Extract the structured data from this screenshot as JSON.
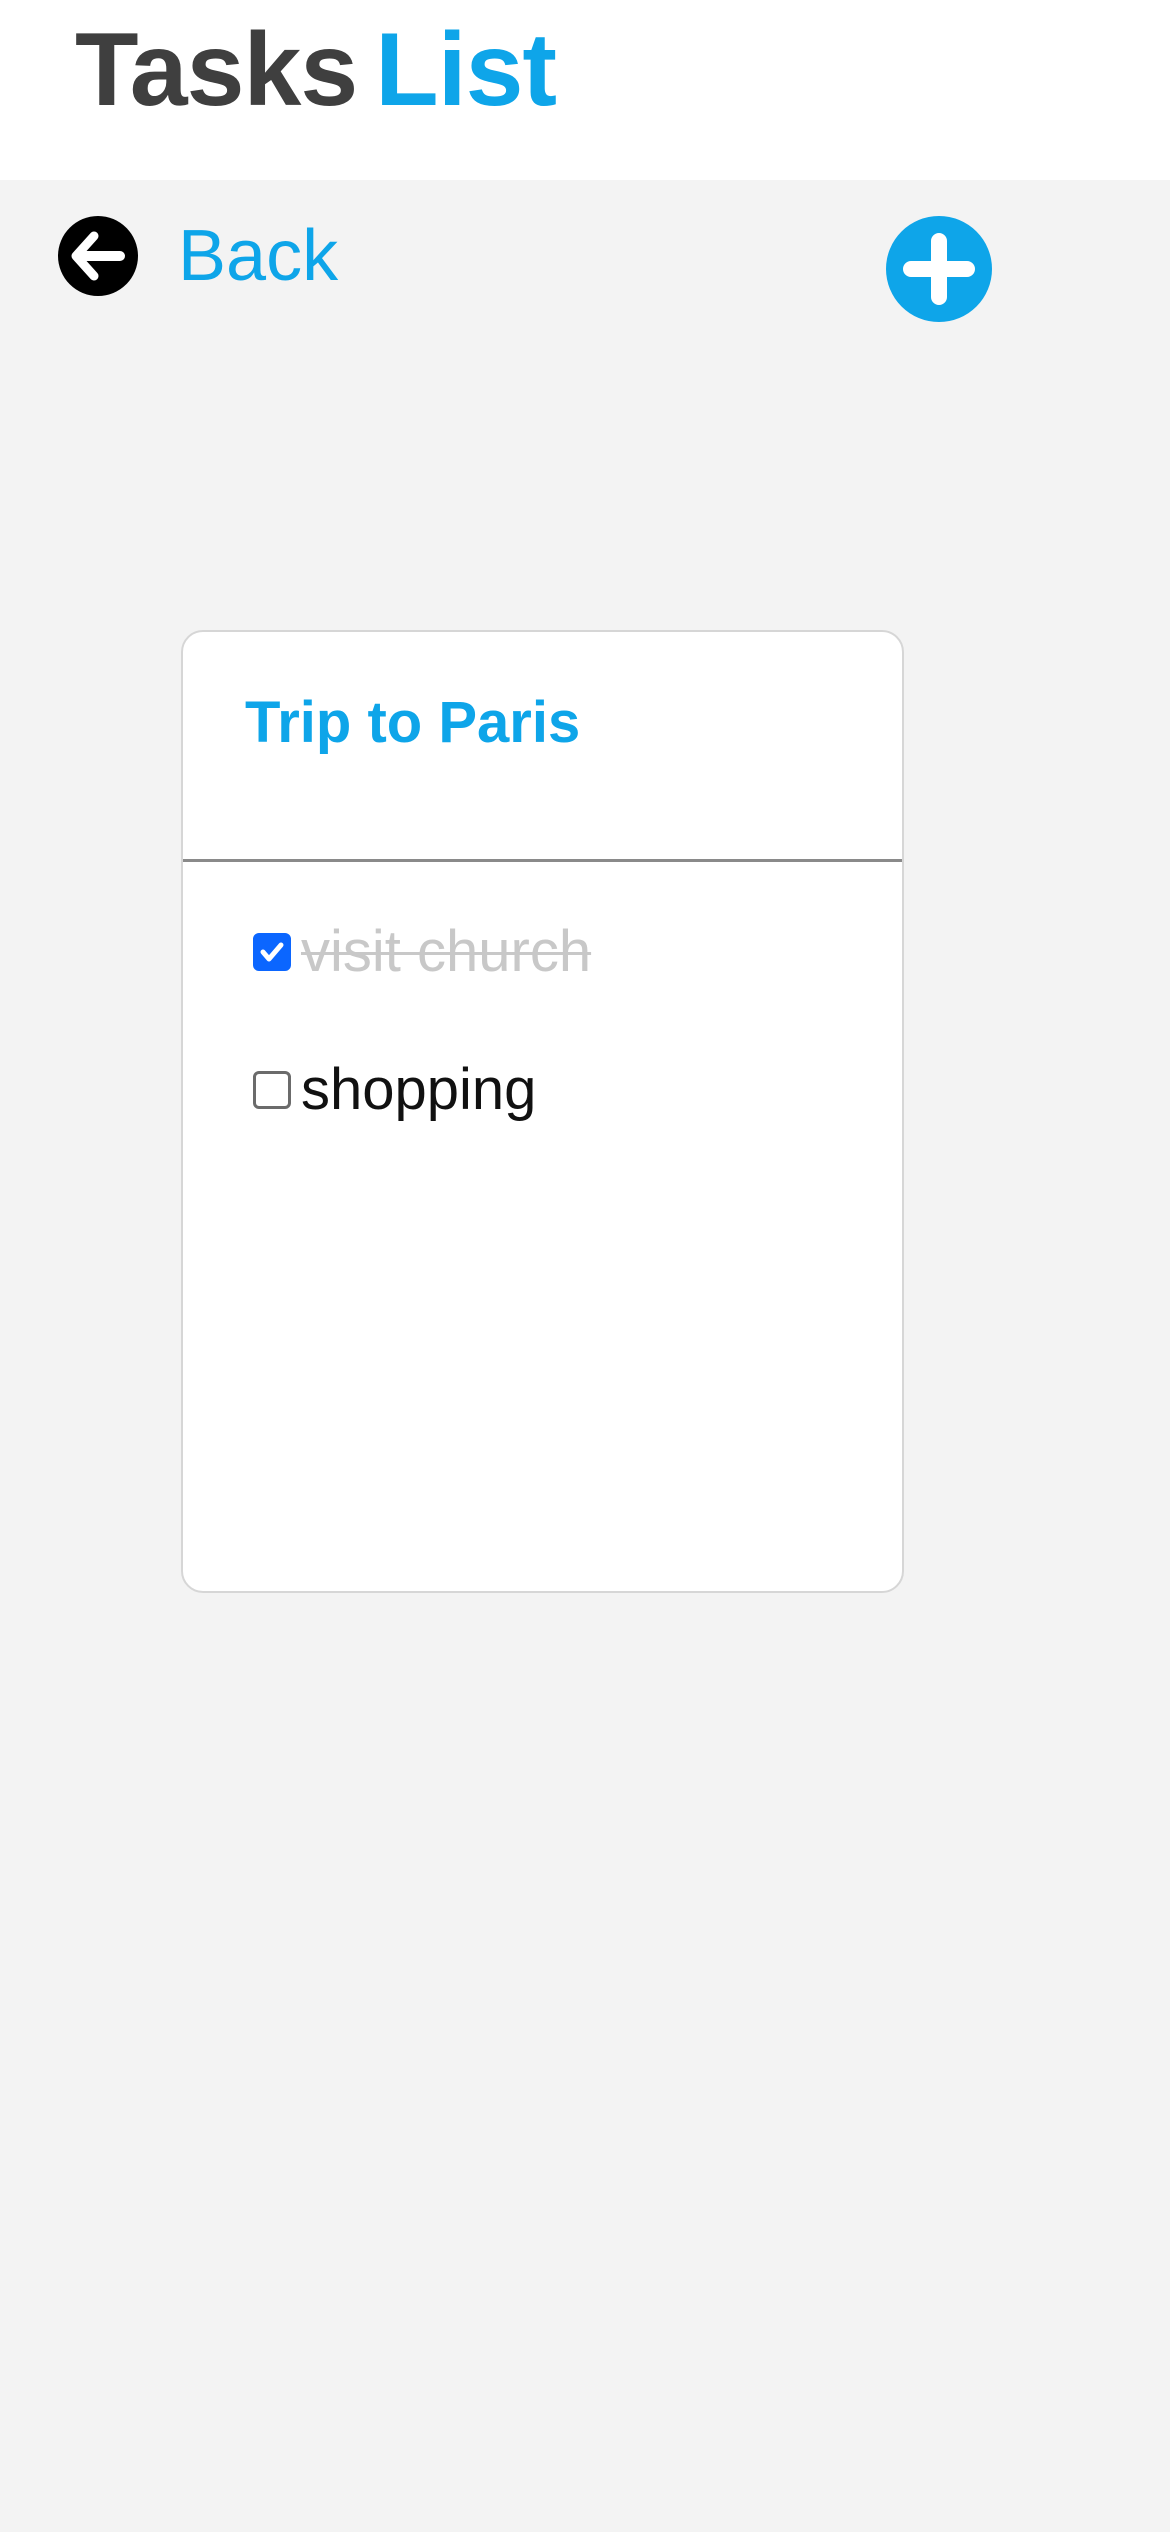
{
  "header": {
    "title_part1": "Tasks",
    "title_part2": "List"
  },
  "nav": {
    "back_label": "Back",
    "back_icon": "arrow-left-circle-icon",
    "add_icon": "plus-circle-icon"
  },
  "card": {
    "title": "Trip to Paris",
    "tasks": [
      {
        "label": "visit church",
        "completed": true
      },
      {
        "label": "shopping",
        "completed": false
      }
    ]
  },
  "colors": {
    "accent": "#0ea5e9",
    "title_dark": "#3f3f3f",
    "checkbox_checked": "#0b66ff",
    "completed_text": "#c8c8c8",
    "background": "#f3f3f3"
  }
}
